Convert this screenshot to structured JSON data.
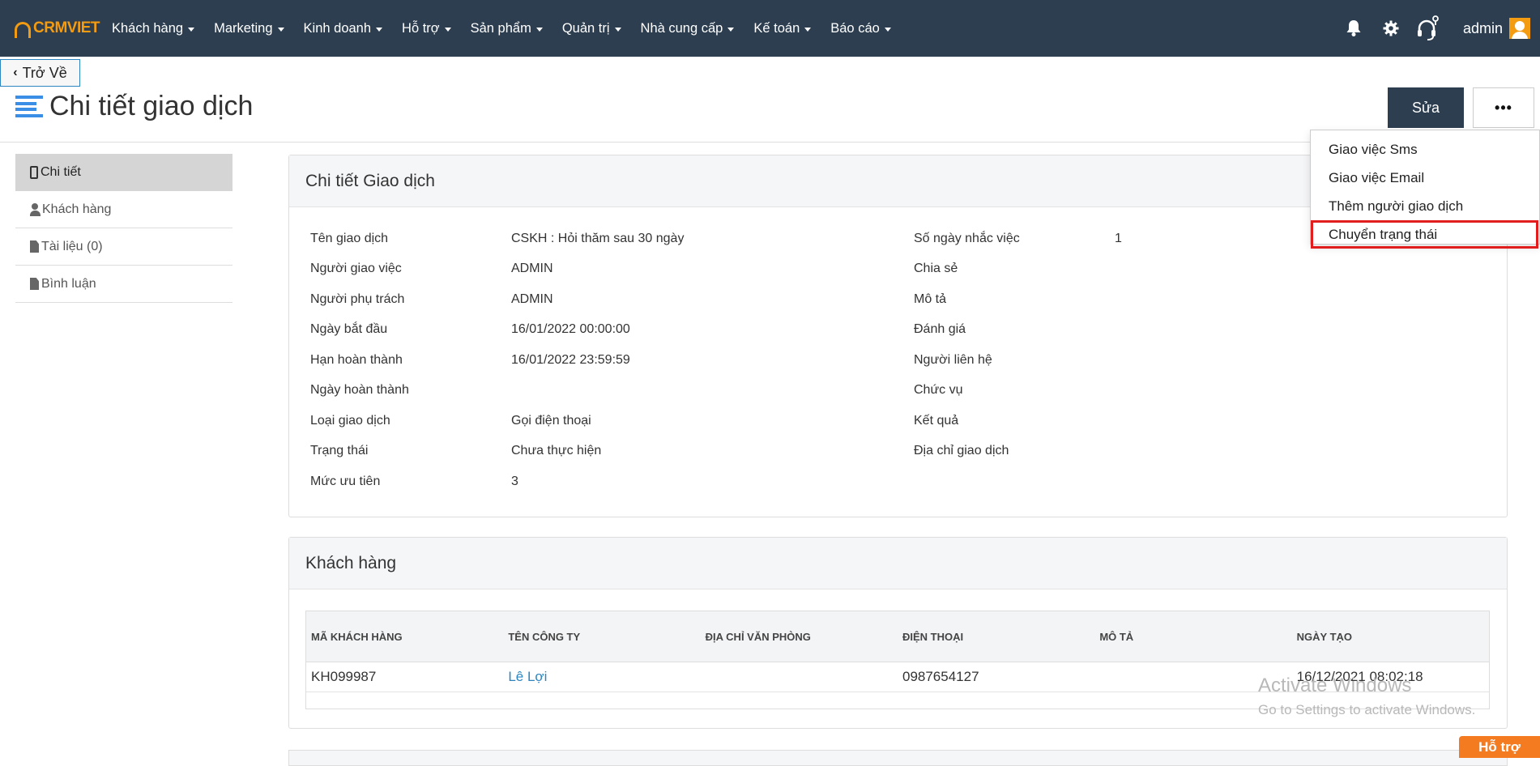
{
  "nav": {
    "logo_text": "CRMVIET",
    "items": [
      {
        "label": "Khách hàng",
        "dropdown": true
      },
      {
        "label": "Marketing",
        "dropdown": true
      },
      {
        "label": "Kinh doanh",
        "dropdown": true
      },
      {
        "label": "Hỗ trợ",
        "dropdown": true
      },
      {
        "label": "Sản phẩm",
        "dropdown": true
      },
      {
        "label": "Quản trị",
        "dropdown": true
      },
      {
        "label": "Nhà cung cấp",
        "dropdown": true
      },
      {
        "label": "Kế toán",
        "dropdown": true
      },
      {
        "label": "Báo cáo",
        "dropdown": true
      }
    ],
    "icons": [
      "bell-icon",
      "gear-icon",
      "headset-icon"
    ],
    "user": "admin"
  },
  "back_label": "Trở Về",
  "page_title": "Chi tiết giao dịch",
  "edit_label": "Sửa",
  "more_label": "•••",
  "dropdown_menu": {
    "items": [
      "Giao việc Sms",
      "Giao việc Email",
      "Thêm người giao dịch",
      "Chuyển trạng thái"
    ],
    "highlighted": "Chuyển trạng thái"
  },
  "sidebar": {
    "items": [
      "Chi tiết",
      "Khách hàng",
      "Tài liệu (0)",
      "Bình luận"
    ]
  },
  "detail": {
    "title": "Chi tiết Giao dịch",
    "left": [
      {
        "label": "Tên giao dịch",
        "value": "CSKH : Hỏi thăm sau 30 ngày"
      },
      {
        "label": "Người giao việc",
        "value": "ADMIN"
      },
      {
        "label": "Người phụ trách",
        "value": "ADMIN"
      },
      {
        "label": "Ngày bắt đầu",
        "value": "16/01/2022 00:00:00"
      },
      {
        "label": "Hạn hoàn thành",
        "value": "16/01/2022 23:59:59"
      },
      {
        "label": "Ngày hoàn thành",
        "value": ""
      },
      {
        "label": "Loại giao dịch",
        "value": "Gọi điện thoại"
      },
      {
        "label": "Trạng thái",
        "value": "Chưa thực hiện"
      },
      {
        "label": "Mức ưu tiên",
        "value": "3"
      }
    ],
    "right": [
      {
        "label": "Số ngày nhắc việc",
        "value": "1"
      },
      {
        "label": "Chia sẻ",
        "value": ""
      },
      {
        "label": "Mô tả",
        "value": ""
      },
      {
        "label": "Đánh giá",
        "value": ""
      },
      {
        "label": "Người liên hệ",
        "value": ""
      },
      {
        "label": "Chức vụ",
        "value": ""
      },
      {
        "label": "Kết quả",
        "value": ""
      },
      {
        "label": "Địa chỉ giao dịch",
        "value": ""
      }
    ]
  },
  "customer": {
    "title": "Khách hàng",
    "columns": [
      "MÃ KHÁCH HÀNG",
      "TÊN CÔNG TY",
      "ĐỊA CHỈ VĂN PHÒNG",
      "ĐIỆN THOẠI",
      "MÔ TẢ",
      "NGÀY TẠO"
    ],
    "rows": [
      [
        "KH099987",
        "Lê Lợi",
        "",
        "0987654127",
        "",
        "16/12/2021 08:02:18"
      ]
    ]
  },
  "watermark": {
    "title": "Activate Windows",
    "subtitle": "Go to Settings to activate Windows."
  },
  "support_label": "Hỗ trợ",
  "colors": {
    "nav_bg": "#2c3e50",
    "accent": "#f39c12",
    "link": "#2e86c1",
    "highlight": "#e21d1d",
    "support": "#f47b20"
  }
}
